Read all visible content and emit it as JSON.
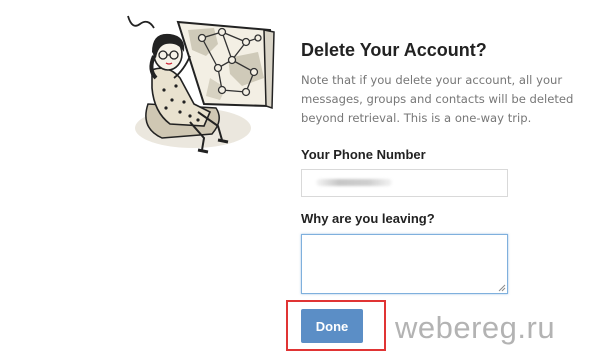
{
  "dialog": {
    "title": "Delete Your Account?",
    "description": "Note that if you delete your account, all your messages, groups and contacts will be deleted beyond retrieval. This is a one-way trip."
  },
  "form": {
    "phone_label": "Your Phone Number",
    "phone_value": "",
    "reason_label": "Why are you leaving?",
    "reason_value": "",
    "done_label": "Done"
  },
  "watermark": "webereg.ru",
  "colors": {
    "button": "#5b8ec6",
    "highlight": "#e03434",
    "focus_border": "#7fb0dd"
  },
  "icons": {
    "illustration": "telegram-delete-account-illustration",
    "textarea_grip": "resize-grip-icon"
  }
}
